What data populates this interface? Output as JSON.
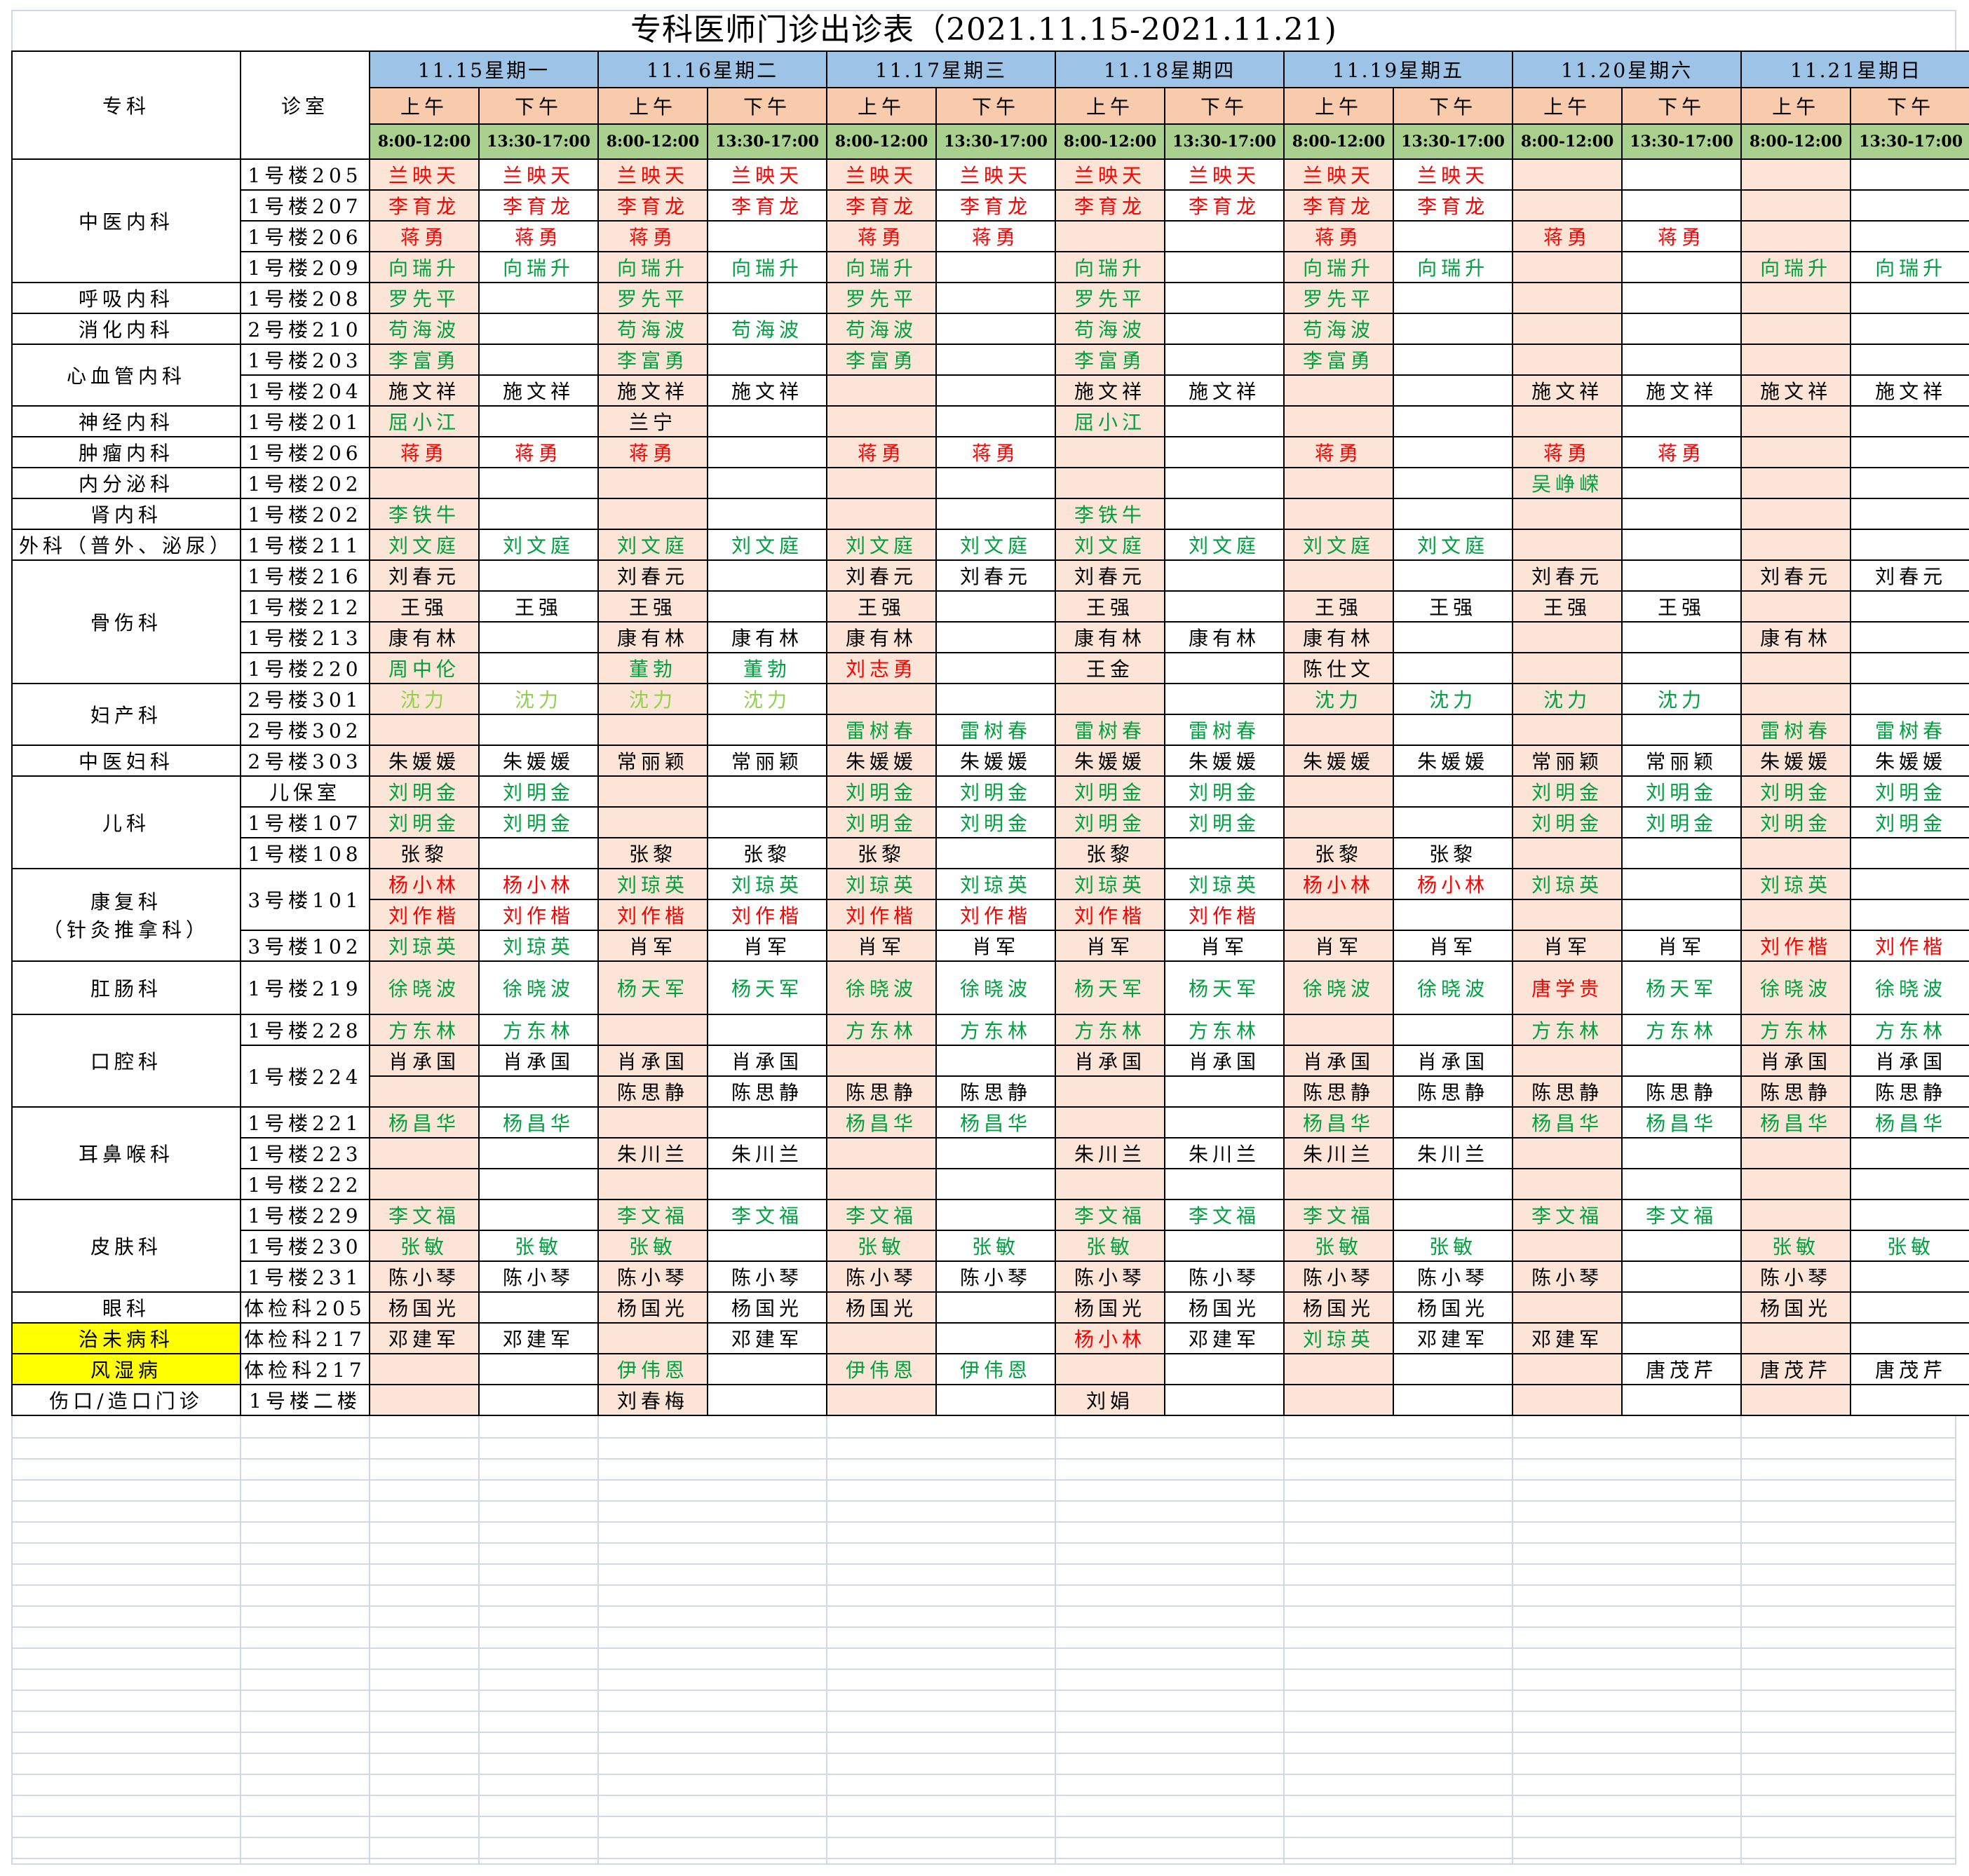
{
  "title": "专科医师门诊出诊表（2021.11.15-2021.11.21)",
  "header": {
    "dept_label": "专科",
    "room_label": "诊室",
    "days": [
      "11.15星期一",
      "11.16星期二",
      "11.17星期三",
      "11.18星期四",
      "11.19星期五",
      "11.20星期六",
      "11.21星期日"
    ],
    "am_label": "上午",
    "pm_label": "下午",
    "am_time": "8:00-12:00",
    "pm_time": "13:30-17:00"
  },
  "colors": {
    "red": "#ff0000",
    "green": "#00a040",
    "lime": "#92d050",
    "black": "#000000",
    "highlight": "#ffff00"
  },
  "groups": [
    {
      "dept": "中医内科",
      "rows": [
        {
          "room": "1号楼205",
          "cells": [
            "r:兰映天",
            "r:兰映天",
            "r:兰映天",
            "r:兰映天",
            "r:兰映天",
            "r:兰映天",
            "r:兰映天",
            "r:兰映天",
            "r:兰映天",
            "r:兰映天",
            "",
            "",
            "",
            ""
          ]
        },
        {
          "room": "1号楼207",
          "cells": [
            "r:李育龙",
            "r:李育龙",
            "r:李育龙",
            "r:李育龙",
            "r:李育龙",
            "r:李育龙",
            "r:李育龙",
            "r:李育龙",
            "r:李育龙",
            "r:李育龙",
            "",
            "",
            "",
            ""
          ]
        },
        {
          "room": "1号楼206",
          "cells": [
            "r:蒋勇",
            "r:蒋勇",
            "r:蒋勇",
            "",
            "r:蒋勇",
            "r:蒋勇",
            "",
            "",
            "r:蒋勇",
            "",
            "r:蒋勇",
            "r:蒋勇",
            "",
            ""
          ]
        },
        {
          "room": "1号楼209",
          "cells": [
            "g:向瑞升",
            "g:向瑞升",
            "g:向瑞升",
            "g:向瑞升",
            "g:向瑞升",
            "",
            "g:向瑞升",
            "",
            "g:向瑞升",
            "g:向瑞升",
            "",
            "",
            "g:向瑞升",
            "g:向瑞升"
          ]
        }
      ]
    },
    {
      "dept": "呼吸内科",
      "rows": [
        {
          "room": "1号楼208",
          "cells": [
            "g:罗先平",
            "",
            "g:罗先平",
            "",
            "g:罗先平",
            "",
            "g:罗先平",
            "",
            "g:罗先平",
            "",
            "",
            "",
            "",
            ""
          ]
        }
      ]
    },
    {
      "dept": "消化内科",
      "rows": [
        {
          "room": "2号楼210",
          "cells": [
            "g:苟海波",
            "",
            "g:苟海波",
            "g:苟海波",
            "g:苟海波",
            "",
            "g:苟海波",
            "",
            "g:苟海波",
            "",
            "",
            "",
            "",
            ""
          ]
        }
      ]
    },
    {
      "dept": "心血管内科",
      "rows": [
        {
          "room": "1号楼203",
          "cells": [
            "g:李富勇",
            "",
            "g:李富勇",
            "",
            "g:李富勇",
            "",
            "g:李富勇",
            "",
            "g:李富勇",
            "",
            "",
            "",
            "",
            ""
          ]
        },
        {
          "room": "1号楼204",
          "cells": [
            "k:施文祥",
            "k:施文祥",
            "k:施文祥",
            "k:施文祥",
            "",
            "",
            "k:施文祥",
            "k:施文祥",
            "",
            "",
            "k:施文祥",
            "k:施文祥",
            "k:施文祥",
            "k:施文祥"
          ]
        }
      ]
    },
    {
      "dept": "神经内科",
      "rows": [
        {
          "room": "1号楼201",
          "cells": [
            "g:屈小江",
            "",
            "k:兰宁",
            "",
            "",
            "",
            "g:屈小江",
            "",
            "",
            "",
            "",
            "",
            "",
            ""
          ]
        }
      ]
    },
    {
      "dept": "肿瘤内科",
      "rows": [
        {
          "room": "1号楼206",
          "cells": [
            "r:蒋勇",
            "r:蒋勇",
            "r:蒋勇",
            "",
            "r:蒋勇",
            "r:蒋勇",
            "",
            "",
            "r:蒋勇",
            "",
            "r:蒋勇",
            "r:蒋勇",
            "",
            ""
          ]
        }
      ]
    },
    {
      "dept": "内分泌科",
      "rows": [
        {
          "room": "1号楼202",
          "cells": [
            "",
            "",
            "",
            "",
            "",
            "",
            "",
            "",
            "",
            "",
            "g:吴峥嵘",
            "",
            "",
            ""
          ]
        }
      ]
    },
    {
      "dept": "肾内科",
      "rows": [
        {
          "room": "1号楼202",
          "cells": [
            "g:李铁牛",
            "",
            "",
            "",
            "",
            "",
            "g:李铁牛",
            "",
            "",
            "",
            "",
            "",
            "",
            ""
          ]
        }
      ]
    },
    {
      "dept": "外科（普外、泌尿）",
      "rows": [
        {
          "room": "1号楼211",
          "cells": [
            "g:刘文庭",
            "g:刘文庭",
            "g:刘文庭",
            "g:刘文庭",
            "g:刘文庭",
            "g:刘文庭",
            "g:刘文庭",
            "g:刘文庭",
            "g:刘文庭",
            "g:刘文庭",
            "",
            "",
            "",
            ""
          ]
        }
      ]
    },
    {
      "dept": "骨伤科",
      "rows": [
        {
          "room": "1号楼216",
          "cells": [
            "k:刘春元",
            "",
            "k:刘春元",
            "",
            "k:刘春元",
            "k:刘春元",
            "k:刘春元",
            "",
            "",
            "",
            "k:刘春元",
            "",
            "k:刘春元",
            "k:刘春元"
          ]
        },
        {
          "room": "1号楼212",
          "cells": [
            "k:王强",
            "k:王强",
            "k:王强",
            "",
            "k:王强",
            "",
            "k:王强",
            "",
            "k:王强",
            "k:王强",
            "k:王强",
            "k:王强",
            "",
            ""
          ]
        },
        {
          "room": "1号楼213",
          "cells": [
            "k:康有林",
            "",
            "k:康有林",
            "k:康有林",
            "k:康有林",
            "",
            "k:康有林",
            "k:康有林",
            "k:康有林",
            "",
            "",
            "",
            "k:康有林",
            ""
          ]
        },
        {
          "room": "1号楼220",
          "cells": [
            "g:周中伦",
            "",
            "g:董勃",
            "g:董勃",
            "r:刘志勇",
            "",
            "k:王金",
            "",
            "k:陈仕文",
            "",
            "",
            "",
            "",
            ""
          ]
        }
      ]
    },
    {
      "dept": "妇产科",
      "rows": [
        {
          "room": "2号楼301",
          "cells": [
            "l:沈力",
            "l:沈力",
            "l:沈力",
            "l:沈力",
            "",
            "",
            "",
            "",
            "g:沈力",
            "g:沈力",
            "g:沈力",
            "g:沈力",
            "",
            ""
          ]
        },
        {
          "room": "2号楼302",
          "cells": [
            "",
            "",
            "",
            "",
            "g:雷树春",
            "g:雷树春",
            "g:雷树春",
            "g:雷树春",
            "",
            "",
            "",
            "",
            "g:雷树春",
            "g:雷树春"
          ]
        }
      ]
    },
    {
      "dept": "中医妇科",
      "rows": [
        {
          "room": "2号楼303",
          "cells": [
            "k:朱媛媛",
            "k:朱媛媛",
            "k:常丽颖",
            "k:常丽颖",
            "k:朱媛媛",
            "k:朱媛媛",
            "k:朱媛媛",
            "k:朱媛媛",
            "k:朱媛媛",
            "k:朱媛媛",
            "k:常丽颖",
            "k:常丽颖",
            "k:朱媛媛",
            "k:朱媛媛"
          ]
        }
      ]
    },
    {
      "dept": "儿科",
      "rows": [
        {
          "room": "儿保室",
          "cells": [
            "g:刘明金",
            "g:刘明金",
            "",
            "",
            "g:刘明金",
            "g:刘明金",
            "g:刘明金",
            "g:刘明金",
            "",
            "",
            "g:刘明金",
            "g:刘明金",
            "g:刘明金",
            "g:刘明金"
          ]
        },
        {
          "room": "1号楼107",
          "cells": [
            "g:刘明金",
            "g:刘明金",
            "",
            "",
            "g:刘明金",
            "g:刘明金",
            "g:刘明金",
            "g:刘明金",
            "",
            "",
            "g:刘明金",
            "g:刘明金",
            "g:刘明金",
            "g:刘明金"
          ]
        },
        {
          "room": "1号楼108",
          "cells": [
            "k:张黎",
            "",
            "k:张黎",
            "k:张黎",
            "k:张黎",
            "",
            "k:张黎",
            "",
            "k:张黎",
            "k:张黎",
            "",
            "",
            "",
            ""
          ]
        }
      ]
    },
    {
      "dept": "康复科",
      "dept_sub": "（针灸推拿科）",
      "rows": [
        {
          "room": "3号楼101",
          "room_rows": 2,
          "cells": [
            "r:杨小林",
            "r:杨小林",
            "g:刘琼英",
            "g:刘琼英",
            "g:刘琼英",
            "g:刘琼英",
            "g:刘琼英",
            "g:刘琼英",
            "r:杨小林",
            "r:杨小林",
            "g:刘琼英",
            "",
            "g:刘琼英",
            ""
          ]
        },
        {
          "room": null,
          "cells": [
            "r:刘作楷",
            "r:刘作楷",
            "r:刘作楷",
            "r:刘作楷",
            "r:刘作楷",
            "r:刘作楷",
            "r:刘作楷",
            "r:刘作楷",
            "",
            "",
            "",
            "",
            "",
            ""
          ]
        },
        {
          "room": "3号楼102",
          "cells": [
            "g:刘琼英",
            "g:刘琼英",
            "k:肖军",
            "k:肖军",
            "k:肖军",
            "k:肖军",
            "k:肖军",
            "k:肖军",
            "k:肖军",
            "k:肖军",
            "k:肖军",
            "k:肖军",
            "r:刘作楷",
            "r:刘作楷"
          ]
        }
      ]
    },
    {
      "dept": "肛肠科",
      "tall": true,
      "rows": [
        {
          "room": "1号楼219",
          "cells": [
            "g:徐晓波",
            "g:徐晓波",
            "g:杨天军",
            "g:杨天军",
            "g:徐晓波",
            "g:徐晓波",
            "g:杨天军",
            "g:杨天军",
            "g:徐晓波",
            "g:徐晓波",
            "r:唐学贵",
            "g:杨天军",
            "g:徐晓波",
            "g:徐晓波"
          ]
        }
      ]
    },
    {
      "dept": "口腔科",
      "rows": [
        {
          "room": "1号楼228",
          "cells": [
            "g:方东林",
            "g:方东林",
            "",
            "",
            "g:方东林",
            "g:方东林",
            "g:方东林",
            "g:方东林",
            "",
            "",
            "g:方东林",
            "g:方东林",
            "g:方东林",
            "g:方东林"
          ]
        },
        {
          "room": "1号楼224",
          "room_rows": 2,
          "cells": [
            "k:肖承国",
            "k:肖承国",
            "k:肖承国",
            "k:肖承国",
            "",
            "",
            "k:肖承国",
            "k:肖承国",
            "k:肖承国",
            "k:肖承国",
            "",
            "",
            "k:肖承国",
            "k:肖承国"
          ]
        },
        {
          "room": null,
          "cells": [
            "",
            "",
            "k:陈思静",
            "k:陈思静",
            "k:陈思静",
            "k:陈思静",
            "",
            "",
            "k:陈思静",
            "k:陈思静",
            "k:陈思静",
            "k:陈思静",
            "k:陈思静",
            "k:陈思静"
          ]
        }
      ]
    },
    {
      "dept": "耳鼻喉科",
      "rows": [
        {
          "room": "1号楼221",
          "cells": [
            "g:杨昌华",
            "g:杨昌华",
            "",
            "",
            "g:杨昌华",
            "g:杨昌华",
            "",
            "",
            "g:杨昌华",
            "",
            "g:杨昌华",
            "g:杨昌华",
            "g:杨昌华",
            "g:杨昌华"
          ]
        },
        {
          "room": "1号楼223",
          "cells": [
            "",
            "",
            "k:朱川兰",
            "k:朱川兰",
            "",
            "",
            "k:朱川兰",
            "k:朱川兰",
            "k:朱川兰",
            "k:朱川兰",
            "",
            "",
            "",
            ""
          ]
        },
        {
          "room": "1号楼222",
          "cells": [
            "",
            "",
            "",
            "",
            "",
            "",
            "",
            "",
            "",
            "",
            "",
            "",
            "",
            ""
          ]
        }
      ]
    },
    {
      "dept": "皮肤科",
      "rows": [
        {
          "room": "1号楼229",
          "cells": [
            "g:李文福",
            "",
            "g:李文福",
            "g:李文福",
            "g:李文福",
            "",
            "g:李文福",
            "g:李文福",
            "g:李文福",
            "",
            "g:李文福",
            "g:李文福",
            "",
            ""
          ]
        },
        {
          "room": "1号楼230",
          "cells": [
            "g:张敏",
            "g:张敏",
            "g:张敏",
            "",
            "g:张敏",
            "g:张敏",
            "g:张敏",
            "",
            "g:张敏",
            "g:张敏",
            "",
            "",
            "g:张敏",
            "g:张敏"
          ]
        },
        {
          "room": "1号楼231",
          "cells": [
            "k:陈小琴",
            "k:陈小琴",
            "k:陈小琴",
            "k:陈小琴",
            "k:陈小琴",
            "k:陈小琴",
            "k:陈小琴",
            "k:陈小琴",
            "k:陈小琴",
            "k:陈小琴",
            "k:陈小琴",
            "",
            "k:陈小琴",
            ""
          ]
        }
      ]
    },
    {
      "dept": "眼科",
      "rows": [
        {
          "room": "体检科205",
          "cells": [
            "k:杨国光",
            "",
            "k:杨国光",
            "k:杨国光",
            "k:杨国光",
            "",
            "k:杨国光",
            "k:杨国光",
            "k:杨国光",
            "k:杨国光",
            "",
            "",
            "k:杨国光",
            ""
          ]
        }
      ]
    },
    {
      "dept": "治未病科",
      "highlight": true,
      "rows": [
        {
          "room": "体检科217",
          "cells": [
            "k:邓建军",
            "k:邓建军",
            "",
            "k:邓建军",
            "",
            "",
            "r:杨小林",
            "k:邓建军",
            "g:刘琼英",
            "k:邓建军",
            "k:邓建军",
            "",
            "",
            ""
          ]
        }
      ]
    },
    {
      "dept": "风湿病",
      "highlight": true,
      "rows": [
        {
          "room": "体检科217",
          "cells": [
            "",
            "",
            "g:伊伟恩",
            "",
            "g:伊伟恩",
            "g:伊伟恩",
            "",
            "",
            "",
            "",
            "",
            "k:唐茂芹",
            "k:唐茂芹",
            "k:唐茂芹"
          ]
        }
      ]
    },
    {
      "dept": "伤口/造口门诊",
      "rows": [
        {
          "room": "1号楼二楼",
          "cells": [
            "",
            "",
            "k:刘春梅",
            "",
            "",
            "",
            "k:刘娟",
            "",
            "",
            "",
            "",
            "",
            "",
            ""
          ]
        }
      ]
    }
  ]
}
